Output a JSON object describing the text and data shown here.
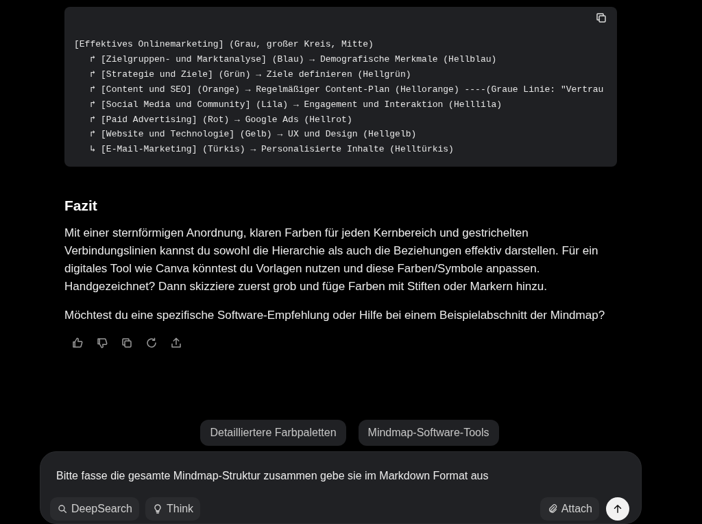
{
  "code_block": {
    "lines": [
      {
        "text": "[Effektives Onlinemarketing] (Grau, großer Kreis, Mitte)"
      },
      {
        "marker": "↱",
        "text": "[Zielgruppen- und Marktanalyse] (Blau) → Demografische Merkmale (Hellblau)"
      },
      {
        "marker": "↱",
        "text": "[Strategie und Ziele] (Grün) → Ziele definieren (Hellgrün)"
      },
      {
        "marker": "↱",
        "text": "[Content und SEO] (Orange) → Regelmäßiger Content-Plan (Hellorange) ----(Graue Linie: \"Vertrau"
      },
      {
        "marker": "↱",
        "text": "[Social Media und Community] (Lila) → Engagement und Interaktion (Helllila)"
      },
      {
        "marker": "↱",
        "text": "[Paid Advertising] (Rot) → Google Ads (Hellrot)"
      },
      {
        "marker": "↱",
        "text": "[Website und Technologie] (Gelb) → UX und Design (Hellgelb)"
      },
      {
        "marker": "↳",
        "text": "[E-Mail-Marketing] (Türkis) → Personalisierte Inhalte (Helltürkis)"
      }
    ]
  },
  "heading": "Fazit",
  "paragraphs": [
    "Mit einer sternförmigen Anordnung, klaren Farben für jeden Kernbereich und gestrichelten Verbindungslinien kannst du sowohl die Hierarchie als auch die Beziehungen effektiv darstellen. Für ein digitales Tool wie Canva könntest du Vorlagen nutzen und diese Farben/Symbole anpassen. Handgezeichnet? Dann skizziere zuerst grob und füge Farben mit Stiften oder Markern hinzu.",
    "Möchtest du eine spezifische Software-Empfehlung oder Hilfe bei einem Beispielabschnitt der Mindmap?"
  ],
  "actions": [
    {
      "kind": "like"
    },
    {
      "kind": "dislike"
    },
    {
      "kind": "copy"
    },
    {
      "kind": "regenerate"
    },
    {
      "kind": "share"
    }
  ],
  "suggestions": [
    "Detailliertere Farbpaletten",
    "Mindmap-Software-Tools"
  ],
  "composer": {
    "value": "Bitte fasse die gesamte Mindmap-Struktur zusammen gebe sie im Markdown Format aus",
    "left_buttons": [
      {
        "kind": "search",
        "label": "DeepSearch"
      },
      {
        "kind": "bulb",
        "label": "Think"
      }
    ],
    "attach": "Attach"
  }
}
